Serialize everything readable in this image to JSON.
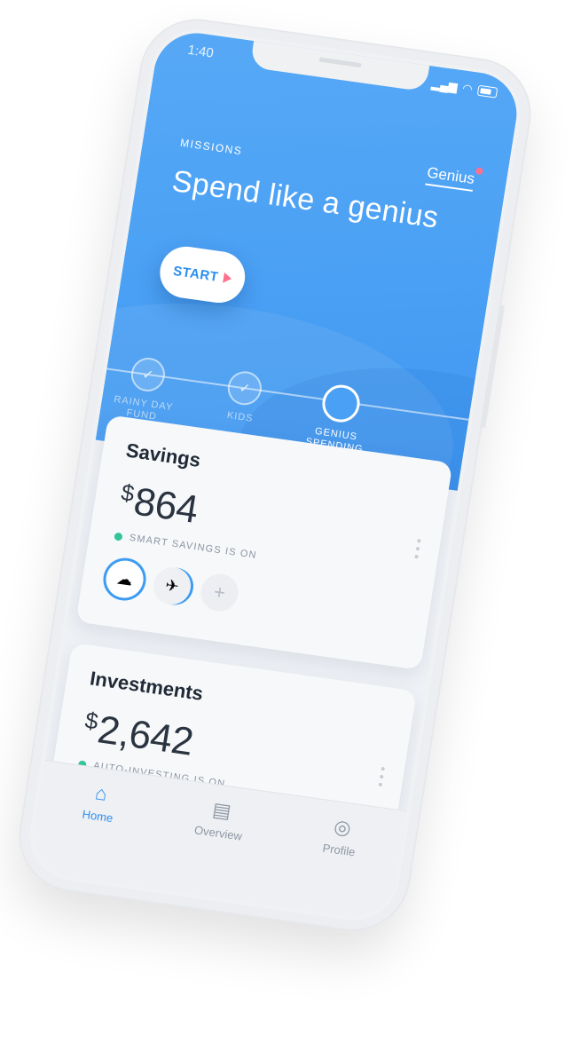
{
  "status_bar": {
    "time": "1:40",
    "signal_icon": "signal-icon",
    "wifi_icon": "wifi-icon",
    "battery_icon": "battery-icon"
  },
  "header": {
    "section_label": "MISSIONS",
    "genius_link": "Genius",
    "title": "Spend like a genius",
    "start_button": "START"
  },
  "missions": [
    {
      "label_line1": "RAINY DAY",
      "label_line2": "FUND",
      "state": "completed"
    },
    {
      "label_line1": "KIDS",
      "label_line2": "",
      "state": "completed"
    },
    {
      "label_line1": "GENIUS",
      "label_line2": "SPENDING",
      "state": "active"
    }
  ],
  "savings": {
    "title": "Savings",
    "currency": "$",
    "amount": "864",
    "status": "SMART SAVINGS IS ON",
    "goals": [
      "rain-cloud-icon",
      "airplane-icon",
      "plus-icon"
    ]
  },
  "investments": {
    "title": "Investments",
    "currency": "$",
    "amount": "2,642",
    "status": "AUTO-INVESTING IS ON"
  },
  "tabbar": {
    "items": [
      {
        "label": "Home",
        "icon": "home-icon",
        "active": true
      },
      {
        "label": "Overview",
        "icon": "overview-icon",
        "active": false
      },
      {
        "label": "Profile",
        "icon": "profile-icon",
        "active": false
      }
    ]
  },
  "colors": {
    "primary_blue": "#4aa0f4",
    "accent_pink": "#ff6f8e",
    "status_green": "#33c49a"
  }
}
